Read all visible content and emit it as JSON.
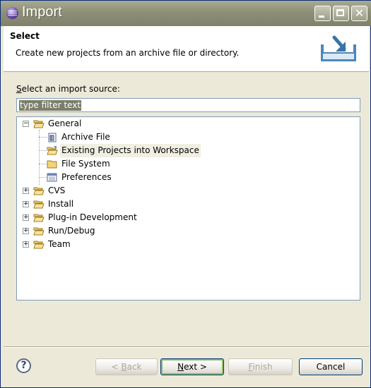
{
  "window": {
    "title": "Import"
  },
  "header": {
    "title": "Select",
    "description": "Create new projects from an archive file or directory."
  },
  "source": {
    "label_accel": "S",
    "label_rest": "elect an import source:",
    "filter_text": "type filter text"
  },
  "tree": {
    "items": [
      {
        "label": "General",
        "expanded": true,
        "icon": "folder-open-icon"
      },
      {
        "label": "Archive File",
        "icon": "archive-file-icon"
      },
      {
        "label": "Existing Projects into Workspace",
        "icon": "existing-projects-icon",
        "selected": true
      },
      {
        "label": "File System",
        "icon": "folder-icon"
      },
      {
        "label": "Preferences",
        "icon": "preferences-icon"
      },
      {
        "label": "CVS",
        "expanded": false,
        "icon": "folder-icon"
      },
      {
        "label": "Install",
        "expanded": false,
        "icon": "folder-icon"
      },
      {
        "label": "Plug-in Development",
        "expanded": false,
        "icon": "folder-icon"
      },
      {
        "label": "Run/Debug",
        "expanded": false,
        "icon": "folder-icon"
      },
      {
        "label": "Team",
        "expanded": false,
        "icon": "folder-icon"
      }
    ]
  },
  "buttons": {
    "back_pre": "< ",
    "back_accel": "B",
    "back_rest": "ack",
    "next_accel": "N",
    "next_rest": "ext >",
    "finish_accel": "F",
    "finish_rest": "inish",
    "cancel": "Cancel"
  },
  "colors": {
    "titlebar": "#8d8f77",
    "selection": "#f1efe2",
    "border": "#7f9db9"
  }
}
